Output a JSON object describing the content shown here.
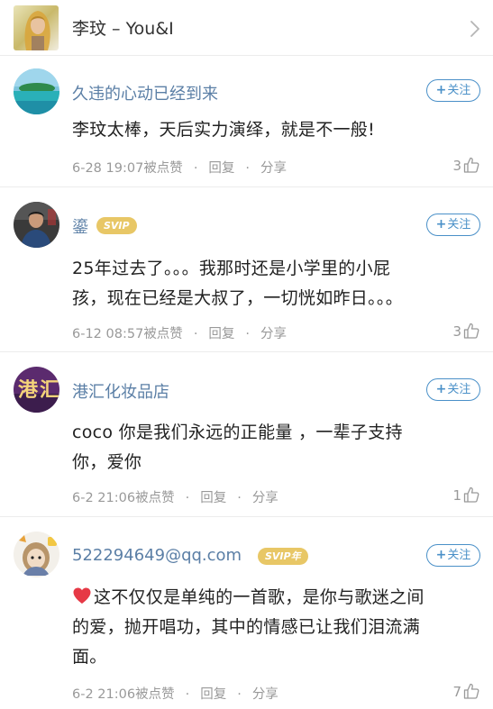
{
  "header": {
    "title": "李玟 – You&I"
  },
  "comments": [
    {
      "username": "久违的心动已经到来",
      "badge": "",
      "follow_label": "关注",
      "text_lines": [
        "李玟太棒，天后实力演绎，就是不一般!"
      ],
      "date": "6-28 19:07",
      "liked_label": "被点赞",
      "reply_label": "回复",
      "share_label": "分享",
      "likes": "3"
    },
    {
      "username": "鎏",
      "badge": "SVIP",
      "follow_label": "关注",
      "text_lines": [
        "25年过去了。。。我那时还是小学里的小屁",
        "孩，现在已经是大叔了，一切恍如昨日。。。"
      ],
      "date": "6-12 08:57",
      "liked_label": "被点赞",
      "reply_label": "回复",
      "share_label": "分享",
      "likes": "3"
    },
    {
      "username": "港汇化妆品店",
      "badge": "",
      "follow_label": "关注",
      "text_lines": [
        "coco 你是我们永远的正能量 ，一辈子支持",
        "你，爱你"
      ],
      "date": "6-2 21:06",
      "liked_label": "被点赞",
      "reply_label": "回复",
      "share_label": "分享",
      "likes": "1"
    },
    {
      "username": "522294649@qq.com",
      "badge": "SVIP年",
      "follow_label": "关注",
      "text_lines": [
        "这不仅仅是单纯的一首歌，是你与歌迷之间",
        "的爱，抛开唱功，其中的情感已让我们泪流满",
        "面。"
      ],
      "date": "6-2 21:06",
      "liked_label": "被点赞",
      "reply_label": "回复",
      "share_label": "分享",
      "likes": "7"
    }
  ],
  "colors": {
    "username": "#5b7fa6",
    "follow_border": "#4a90c8",
    "svip_badge": "#e8c766",
    "meta_text": "#999999"
  },
  "icons": {
    "header_chevron": "chevron-right-icon",
    "like": "thumbs-up-icon",
    "heart": "heart-emoji-icon"
  }
}
